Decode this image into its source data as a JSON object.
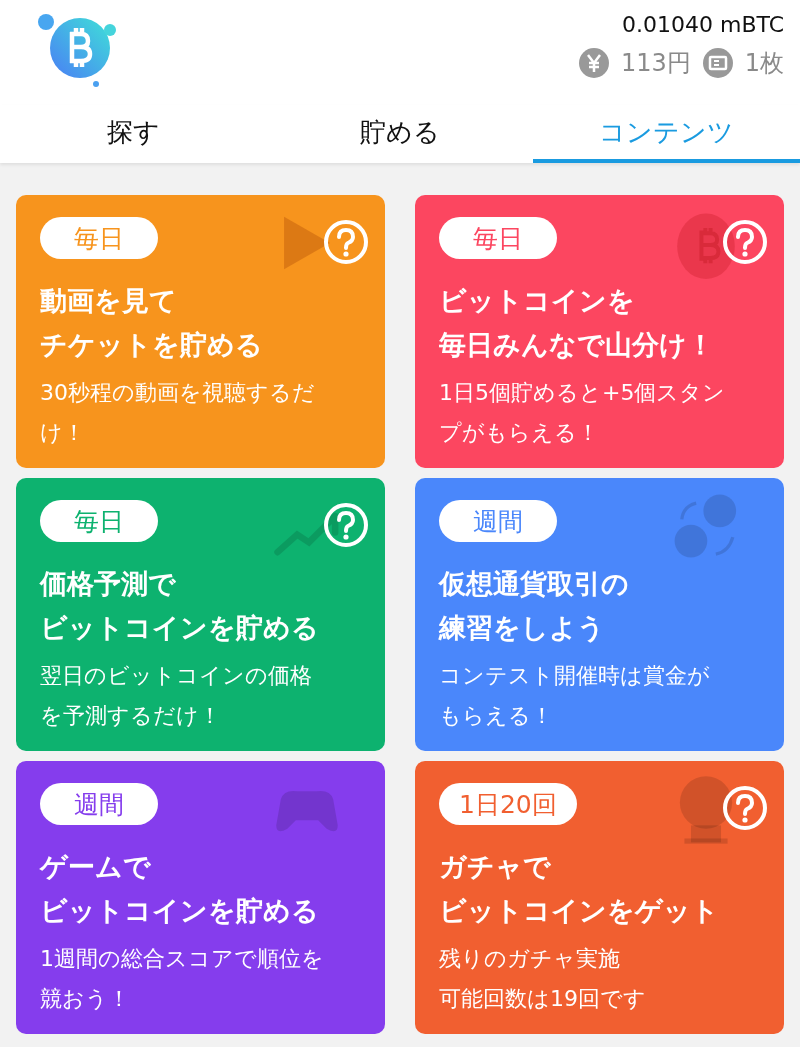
{
  "header": {
    "balance": "0.01040 mBTC",
    "yen": "113円",
    "tickets": "1枚"
  },
  "tabs": [
    {
      "label": "探す",
      "selected": false
    },
    {
      "label": "貯める",
      "selected": false
    },
    {
      "label": "コンテンツ",
      "selected": true
    }
  ],
  "cards": [
    {
      "badge": "毎日",
      "color": "#f7941d",
      "help": true,
      "kind": "play",
      "title_lines": [
        "動画を見て",
        "チケットを貯める"
      ],
      "desc_lines": [
        "30秒程の動画を視聴するだ",
        "け！"
      ]
    },
    {
      "badge": "毎日",
      "color": "#fc4660",
      "help": true,
      "kind": "coin",
      "title_lines": [
        "ビットコインを",
        "毎日みんなで山分け！"
      ],
      "desc_lines": [
        "1日5個貯めると+5個スタン",
        "プがもらえる！"
      ]
    },
    {
      "badge": "毎日",
      "color": "#0db26f",
      "help": true,
      "kind": "chart",
      "title_lines": [
        "価格予測で",
        "ビットコインを貯める"
      ],
      "desc_lines": [
        "翌日のビットコインの価格",
        "を予測するだけ！"
      ]
    },
    {
      "badge": "週間",
      "color": "#4a87fb",
      "help": false,
      "kind": "exchange",
      "title_lines": [
        "仮想通貨取引の",
        "練習をしよう"
      ],
      "desc_lines": [
        "コンテスト開催時は賞金が",
        "もらえる！"
      ]
    },
    {
      "badge": "週間",
      "color": "#853ded",
      "help": false,
      "kind": "gamepad",
      "title_lines": [
        "ゲームで",
        "ビットコインを貯める"
      ],
      "desc_lines": [
        "1週間の総合スコアで順位を",
        "競おう！"
      ]
    },
    {
      "badge": "1日20回",
      "color": "#f15f30",
      "help": true,
      "kind": "gacha",
      "title_lines": [
        "ガチャで",
        "ビットコインをゲット"
      ],
      "desc_lines": [
        "残りのガチャ実施",
        "可能回数は19回です"
      ]
    }
  ]
}
